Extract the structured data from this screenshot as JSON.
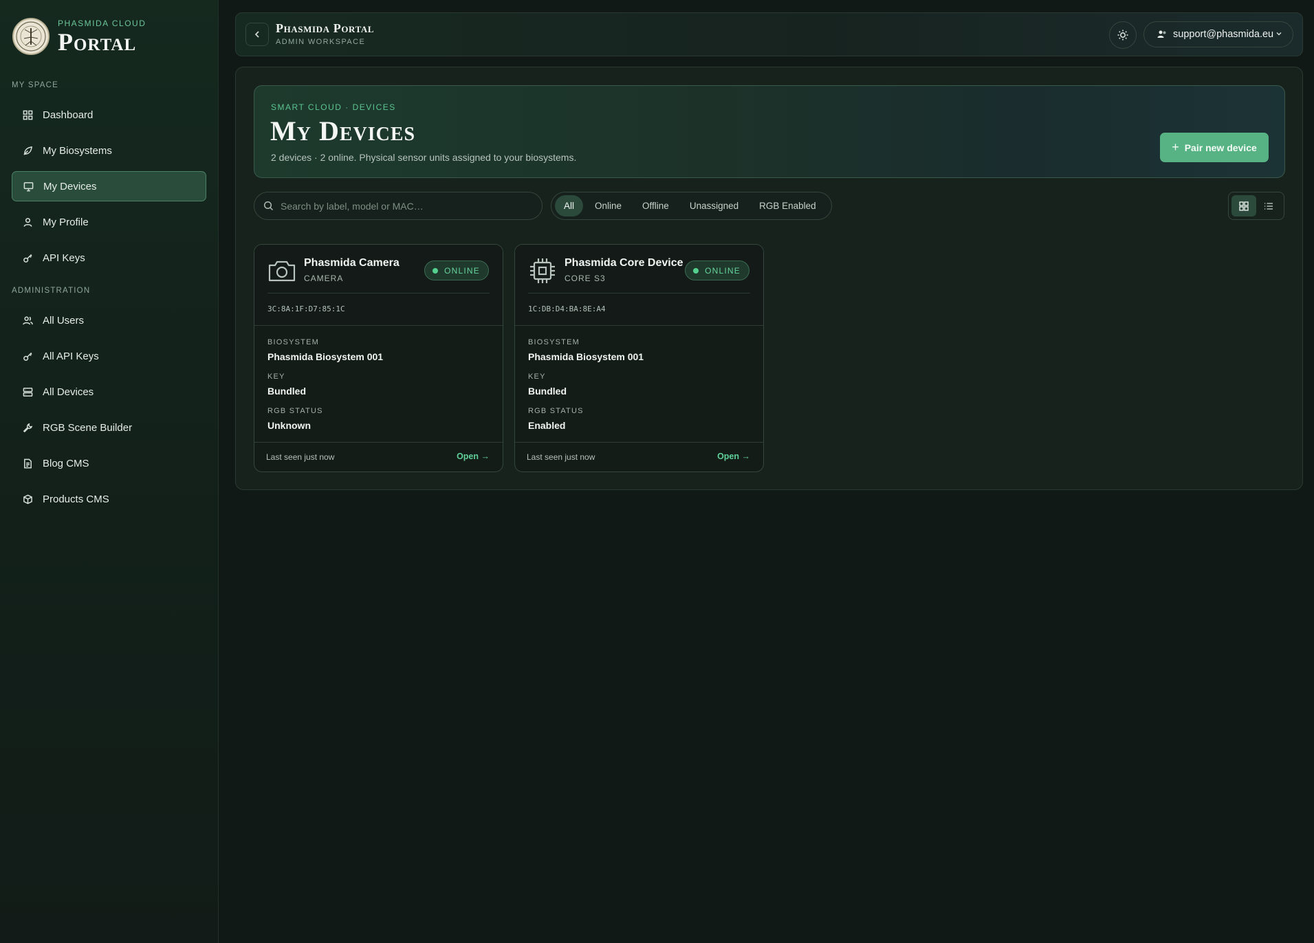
{
  "brand": {
    "small": "Phasmida Cloud",
    "big": "Portal"
  },
  "sidebar": {
    "sections": [
      {
        "label": "My Space"
      },
      {
        "label": "Administration"
      }
    ],
    "items": [
      {
        "label": "Dashboard",
        "icon": "grid-icon"
      },
      {
        "label": "My Biosystems",
        "icon": "leaf-icon"
      },
      {
        "label": "My Devices",
        "icon": "monitor-icon",
        "active": true
      },
      {
        "label": "My Profile",
        "icon": "user-icon"
      },
      {
        "label": "API Keys",
        "icon": "key-icon"
      },
      {
        "label": "All Users",
        "icon": "users-icon"
      },
      {
        "label": "All API Keys",
        "icon": "key-icon"
      },
      {
        "label": "All Devices",
        "icon": "server-icon"
      },
      {
        "label": "RGB Scene Builder",
        "icon": "wrench-icon"
      },
      {
        "label": "Blog CMS",
        "icon": "document-icon"
      },
      {
        "label": "Products CMS",
        "icon": "package-icon"
      }
    ]
  },
  "topbar": {
    "title": "Phasmida Portal",
    "subtitle": "Admin Workspace",
    "account": "support@phasmida.eu"
  },
  "hero": {
    "eyebrow": "Smart Cloud · Devices",
    "title": "My Devices",
    "subtitle": "2 devices · 2 online. Physical sensor units assigned to your biosystems.",
    "pair_button": "Pair new device"
  },
  "search": {
    "placeholder": "Search by label, model or MAC…",
    "value": ""
  },
  "filters": [
    "All",
    "Online",
    "Offline",
    "Unassigned",
    "RGB Enabled"
  ],
  "active_filter": "All",
  "view": "grid",
  "devices": [
    {
      "name": "Phasmida Camera",
      "type": "Camera",
      "icon": "camera-icon",
      "status": "Online",
      "mac": "3C:8A:1F:D7:85:1C",
      "biosystem_label": "Biosystem",
      "biosystem": "Phasmida Biosystem 001",
      "key_label": "Key",
      "key": "Bundled",
      "rgb_label": "RGB Status",
      "rgb": "Unknown",
      "last_seen": "Last seen just now",
      "open": "Open"
    },
    {
      "name": "Phasmida Core Device",
      "type": "Core S3",
      "icon": "chip-icon",
      "status": "Online",
      "mac": "1C:DB:D4:BA:8E:A4",
      "biosystem_label": "Biosystem",
      "biosystem": "Phasmida Biosystem 001",
      "key_label": "Key",
      "key": "Bundled",
      "rgb_label": "RGB Status",
      "rgb": "Enabled",
      "last_seen": "Last seen just now",
      "open": "Open"
    }
  ],
  "colors": {
    "accent": "#58b384",
    "online": "#54d18f",
    "active_nav": "#2a4d3b"
  }
}
